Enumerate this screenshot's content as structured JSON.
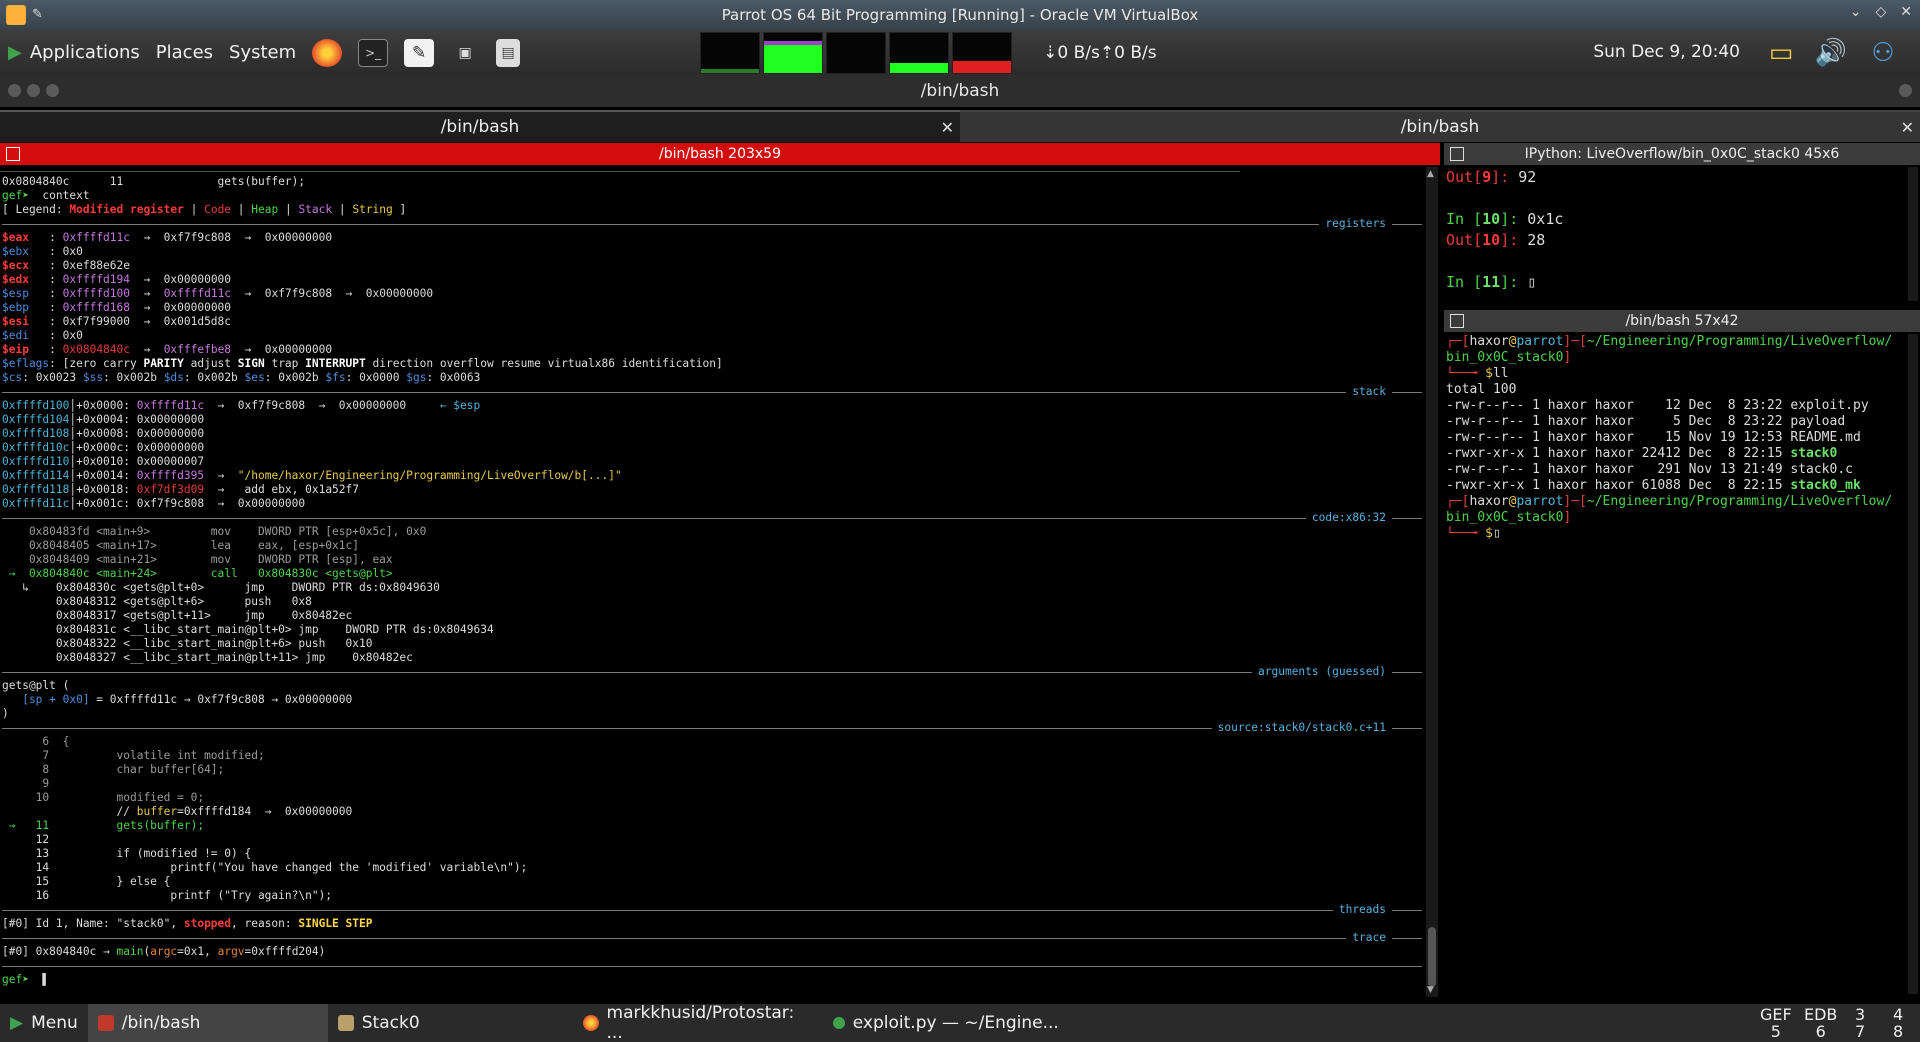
{
  "vbox": {
    "title": "Parrot OS 64 Bit Programming [Running] - Oracle VM VirtualBox"
  },
  "panel": {
    "menus": [
      "Applications",
      "Places",
      "System"
    ],
    "net_down": "0 B/s",
    "net_up": "0 B/s",
    "clock": "Sun Dec  9, 20:40"
  },
  "window": {
    "title": "/bin/bash"
  },
  "tabs": [
    {
      "label": "/bin/bash",
      "active": true
    },
    {
      "label": "/bin/bash",
      "active": false
    }
  ],
  "left_pane": {
    "title": "/bin/bash 203x59",
    "lines": [
      [
        [
          "0x0804840c      11              gets(buffer);",
          "w"
        ]
      ],
      [
        [
          "gef➤  ",
          "g"
        ],
        [
          "context",
          "w"
        ]
      ],
      [
        [
          "[ Legend: ",
          "w"
        ],
        [
          "Modified register",
          "rb"
        ],
        [
          " | ",
          "w"
        ],
        [
          "Code",
          "r"
        ],
        [
          " | ",
          "w"
        ],
        [
          "Heap",
          "g"
        ],
        [
          " | ",
          "w"
        ],
        [
          "Stack",
          "m"
        ],
        [
          " | ",
          "w"
        ],
        [
          "String",
          "y"
        ],
        [
          " ]",
          "w"
        ]
      ],
      {
        "sep": "registers"
      },
      [
        [
          "$eax   ",
          "rb"
        ],
        [
          ": ",
          "w"
        ],
        [
          "0xffffd11c",
          "m"
        ],
        [
          "  →  0xf7f9c808  →  0x00000000",
          "w"
        ]
      ],
      [
        [
          "$ebx   ",
          "b"
        ],
        [
          ": 0x0",
          "w"
        ]
      ],
      [
        [
          "$ecx   ",
          "rb"
        ],
        [
          ": 0xef88e62e",
          "w"
        ]
      ],
      [
        [
          "$edx   ",
          "rb"
        ],
        [
          ": ",
          "w"
        ],
        [
          "0xffffd194",
          "m"
        ],
        [
          "  →  0x00000000",
          "w"
        ]
      ],
      [
        [
          "$esp   ",
          "b"
        ],
        [
          ": ",
          "w"
        ],
        [
          "0xffffd100",
          "m"
        ],
        [
          "  →  ",
          "w"
        ],
        [
          "0xffffd11c",
          "m"
        ],
        [
          "  →  0xf7f9c808  →  0x00000000",
          "w"
        ]
      ],
      [
        [
          "$ebp   ",
          "b"
        ],
        [
          ": ",
          "w"
        ],
        [
          "0xffffd168",
          "m"
        ],
        [
          "  →  0x00000000",
          "w"
        ]
      ],
      [
        [
          "$esi   ",
          "rb"
        ],
        [
          ": 0xf7f99000  →  0x001d5d8c",
          "w"
        ]
      ],
      [
        [
          "$edi   ",
          "b"
        ],
        [
          ": 0x0",
          "w"
        ]
      ],
      [
        [
          "$eip   ",
          "rb"
        ],
        [
          ": ",
          "w"
        ],
        [
          "0x0804840c",
          "r"
        ],
        [
          "  →  ",
          "w"
        ],
        [
          "0xfffefbe8",
          "m"
        ],
        [
          "  →  0x00000000",
          "w"
        ]
      ],
      [
        [
          "$eflags",
          "b"
        ],
        [
          ": [zero carry ",
          "w"
        ],
        [
          "PARITY",
          "wb"
        ],
        [
          " adjust ",
          "w"
        ],
        [
          "SIGN",
          "wb"
        ],
        [
          " trap ",
          "w"
        ],
        [
          "INTERRUPT",
          "wb"
        ],
        [
          " direction overflow resume virtualx86 identification]",
          "w"
        ]
      ],
      [
        [
          "$cs",
          "b"
        ],
        [
          ": 0x0023 ",
          "w"
        ],
        [
          "$ss",
          "b"
        ],
        [
          ": 0x002b ",
          "w"
        ],
        [
          "$ds",
          "b"
        ],
        [
          ": 0x002b ",
          "w"
        ],
        [
          "$es",
          "b"
        ],
        [
          ": 0x002b ",
          "w"
        ],
        [
          "$fs",
          "b"
        ],
        [
          ": 0x0000 ",
          "w"
        ],
        [
          "$gs",
          "b"
        ],
        [
          ": 0x0063",
          "w"
        ]
      ],
      {
        "sep": "stack"
      },
      [
        [
          "0xffffd100",
          "c"
        ],
        [
          "│+0x0000: ",
          "w"
        ],
        [
          "0xffffd11c",
          "m"
        ],
        [
          "  →  0xf7f9c808  →  0x00000000     ",
          "w"
        ],
        [
          "← $esp",
          "c"
        ]
      ],
      [
        [
          "0xffffd104",
          "c"
        ],
        [
          "│+0x0004: 0x00000000",
          "w"
        ]
      ],
      [
        [
          "0xffffd108",
          "c"
        ],
        [
          "│+0x0008: 0x00000000",
          "w"
        ]
      ],
      [
        [
          "0xffffd10c",
          "c"
        ],
        [
          "│+0x000c: 0x00000000",
          "w"
        ]
      ],
      [
        [
          "0xffffd110",
          "c"
        ],
        [
          "│+0x0010: 0x00000007",
          "w"
        ]
      ],
      [
        [
          "0xffffd114",
          "c"
        ],
        [
          "│+0x0014: ",
          "w"
        ],
        [
          "0xffffd395",
          "m"
        ],
        [
          "  →  ",
          "w"
        ],
        [
          "\"/home/haxor/Engineering/Programming/LiveOverflow/b[...]\"",
          "y"
        ]
      ],
      [
        [
          "0xffffd118",
          "c"
        ],
        [
          "│+0x0018: ",
          "w"
        ],
        [
          "0xf7df3d09",
          "r"
        ],
        [
          "  →   add ebx, 0x1a52f7",
          "w"
        ]
      ],
      [
        [
          "0xffffd11c",
          "c"
        ],
        [
          "│+0x001c: 0xf7f9c808  →  0x00000000",
          "w"
        ]
      ],
      {
        "sep": "code:x86:32"
      },
      [
        [
          "    0x80483fd <main+9>         mov    DWORD PTR [esp+0x5c], 0x0",
          "dim"
        ]
      ],
      [
        [
          "    0x8048405 <main+17>        lea    eax, [esp+0x1c]",
          "dim"
        ]
      ],
      [
        [
          "    0x8048409 <main+21>        mov    DWORD PTR [esp], eax",
          "dim"
        ]
      ],
      [
        [
          " →  0x804840c <main+24>        call   0x804830c <gets@plt>",
          "g"
        ]
      ],
      [
        [
          "   ↳    0x804830c <gets@plt+0>      jmp    DWORD PTR ds:0x8049630",
          "w"
        ]
      ],
      [
        [
          "        0x8048312 <gets@plt+6>      push   0x8",
          "w"
        ]
      ],
      [
        [
          "        0x8048317 <gets@plt+11>     jmp    0x80482ec",
          "w"
        ]
      ],
      [
        [
          "        0x804831c <__libc_start_main@plt+0> jmp    DWORD PTR ds:0x8049634",
          "w"
        ]
      ],
      [
        [
          "        0x8048322 <__libc_start_main@plt+6> push   0x10",
          "w"
        ]
      ],
      [
        [
          "        0x8048327 <__libc_start_main@plt+11> jmp    0x80482ec",
          "w"
        ]
      ],
      {
        "sep": "arguments (guessed)"
      },
      [
        [
          "gets@plt (",
          "w"
        ]
      ],
      [
        [
          "   [sp + 0x0]",
          "b"
        ],
        [
          " = 0xffffd11c → 0xf7f9c808 → 0x00000000",
          "w"
        ]
      ],
      [
        [
          ")",
          "w"
        ]
      ],
      {
        "sep": "source:stack0/stack0.c+11"
      },
      [
        [
          "      6  {",
          "dim"
        ]
      ],
      [
        [
          "      7          volatile int modified;",
          "dim"
        ]
      ],
      [
        [
          "      8          char buffer[64];",
          "dim"
        ]
      ],
      [
        [
          "      9",
          "dim"
        ]
      ],
      [
        [
          "     10          modified = 0;",
          "dim"
        ]
      ],
      [
        [
          "                 // ",
          "w"
        ],
        [
          "buffer",
          "y"
        ],
        [
          "=0xffffd184  →  0x00000000",
          "w"
        ]
      ],
      [
        [
          " →   11          gets(buffer);",
          "g"
        ]
      ],
      [
        [
          "     12",
          "w"
        ]
      ],
      [
        [
          "     13          if (modified != 0) {",
          "w"
        ]
      ],
      [
        [
          "     14                  printf(\"You have changed the 'modified' variable\\n\");",
          "w"
        ]
      ],
      [
        [
          "     15          } else {",
          "w"
        ]
      ],
      [
        [
          "     16                  printf (\"Try again?\\n\");",
          "w"
        ]
      ],
      {
        "sep": "threads"
      },
      [
        [
          "[#0] Id 1, Name: \"stack0\", ",
          "w"
        ],
        [
          "stopped",
          "rb"
        ],
        [
          ", reason: ",
          "w"
        ],
        [
          "SINGLE STEP",
          "yb"
        ]
      ],
      {
        "sep": "trace"
      },
      [
        [
          "[#0] 0x804840c → ",
          "w"
        ],
        [
          "main",
          "g"
        ],
        [
          "(",
          "w"
        ],
        [
          "argc",
          "o"
        ],
        [
          "=0x1, ",
          "w"
        ],
        [
          "argv",
          "o"
        ],
        [
          "=0xffffd204)",
          "w"
        ]
      ],
      {
        "sep": ""
      },
      [
        [
          "gef➤  ",
          "g"
        ],
        [
          "▌",
          "w"
        ]
      ]
    ]
  },
  "ipython": {
    "title": "IPython: LiveOverflow/bin_0x0C_stack0 45x6",
    "lines": [
      [
        [
          "Out[",
          "r"
        ],
        [
          "9",
          "rb"
        ],
        [
          "]: ",
          "r"
        ],
        [
          "92",
          "w"
        ]
      ],
      [
        [
          "",
          "w"
        ]
      ],
      [
        [
          "In [",
          "g"
        ],
        [
          "10",
          "gb"
        ],
        [
          "]: ",
          "g"
        ],
        [
          "0x1c",
          "w"
        ]
      ],
      [
        [
          "Out[",
          "r"
        ],
        [
          "10",
          "rb"
        ],
        [
          "]: ",
          "r"
        ],
        [
          "28",
          "w"
        ]
      ],
      [
        [
          "",
          "w"
        ]
      ],
      [
        [
          "In [",
          "g"
        ],
        [
          "11",
          "gb"
        ],
        [
          "]: ",
          "g"
        ],
        [
          "▯",
          "w"
        ]
      ]
    ]
  },
  "bash2": {
    "title": "/bin/bash 57x42",
    "lines": [
      [
        [
          "┌─[",
          "r"
        ],
        [
          "haxor",
          "w"
        ],
        [
          "@",
          "y"
        ],
        [
          "parrot",
          "c"
        ],
        [
          "]─[",
          "r"
        ],
        [
          "~/Engineering/Programming/LiveOverflow/",
          "g"
        ]
      ],
      [
        [
          "bin_0x0C_stack0",
          "g"
        ],
        [
          "]",
          "r"
        ]
      ],
      [
        [
          "└──╼ ",
          "r"
        ],
        [
          "$",
          "y"
        ],
        [
          "ll",
          "w"
        ]
      ],
      [
        [
          "total 100",
          "w"
        ]
      ],
      [
        [
          "-rw-r--r-- 1 haxor haxor    12 Dec  8 23:22 exploit.py",
          "w"
        ]
      ],
      [
        [
          "-rw-r--r-- 1 haxor haxor     5 Dec  8 23:22 payload",
          "w"
        ]
      ],
      [
        [
          "-rw-r--r-- 1 haxor haxor    15 Nov 19 12:53 README.md",
          "w"
        ]
      ],
      [
        [
          "-rwxr-xr-x 1 haxor haxor 22412 Dec  8 22:15 ",
          "w"
        ],
        [
          "stack0",
          "gb"
        ]
      ],
      [
        [
          "-rw-r--r-- 1 haxor haxor   291 Nov 13 21:49 stack0.c",
          "w"
        ]
      ],
      [
        [
          "-rwxr-xr-x 1 haxor haxor 61088 Dec  8 22:15 ",
          "w"
        ],
        [
          "stack0_mk",
          "gb"
        ]
      ],
      [
        [
          "┌─[",
          "r"
        ],
        [
          "haxor",
          "w"
        ],
        [
          "@",
          "y"
        ],
        [
          "parrot",
          "c"
        ],
        [
          "]─[",
          "r"
        ],
        [
          "~/Engineering/Programming/LiveOverflow/",
          "g"
        ]
      ],
      [
        [
          "bin_0x0C_stack0",
          "g"
        ],
        [
          "]",
          "r"
        ]
      ],
      [
        [
          "└──╼ ",
          "r"
        ],
        [
          "$",
          "y"
        ],
        [
          "▯",
          "w"
        ]
      ]
    ]
  },
  "taskbar": {
    "menu": "Menu",
    "tasks": [
      {
        "label": "/bin/bash",
        "icon": "terminal-icon"
      },
      {
        "label": "Stack0",
        "icon": "folder-icon"
      },
      {
        "label": "markkhusid/Protostar: ...",
        "icon": "firefox-icon"
      },
      {
        "label": "exploit.py — ~/Engine...",
        "icon": "editor-icon"
      }
    ],
    "workspaces": [
      [
        "GEF",
        "5"
      ],
      [
        "EDB",
        "6"
      ],
      [
        "3",
        "7"
      ],
      [
        "4",
        "8"
      ]
    ]
  },
  "colors": {
    "accent_red": "#d40c0c",
    "term_bg": "#000000",
    "panel_bg": "#2b2b2b"
  }
}
